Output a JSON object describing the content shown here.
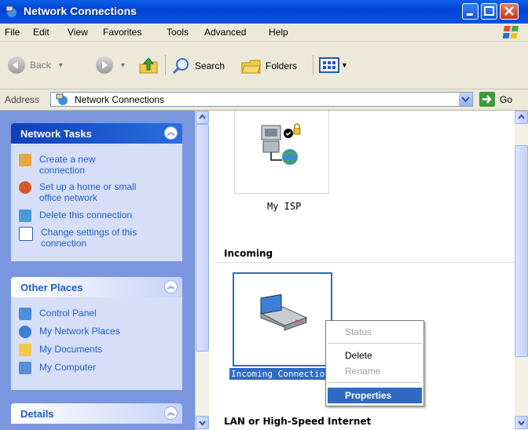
{
  "window": {
    "title": "Network Connections"
  },
  "menu": [
    "File",
    "Edit",
    "View",
    "Favorites",
    "Tools",
    "Advanced",
    "Help"
  ],
  "toolbar": {
    "back_label": "Back",
    "search_label": "Search",
    "folders_label": "Folders"
  },
  "address": {
    "label": "Address",
    "value": "Network Connections",
    "go_label": "Go"
  },
  "network_tasks": {
    "title": "Network Tasks",
    "items": [
      {
        "label": "Create a new connection",
        "icon": "new-connection-icon"
      },
      {
        "label": "Set up a home or small office network",
        "icon": "home-network-icon"
      },
      {
        "label": "Delete this connection",
        "icon": "delete-connection-icon"
      },
      {
        "label": "Change settings of this connection",
        "icon": "settings-icon"
      }
    ]
  },
  "other_places": {
    "title": "Other Places",
    "items": [
      {
        "label": "Control Panel",
        "icon": "control-panel-icon"
      },
      {
        "label": "My Network Places",
        "icon": "network-places-icon"
      },
      {
        "label": "My Documents",
        "icon": "documents-folder-icon"
      },
      {
        "label": "My Computer",
        "icon": "computer-icon"
      }
    ]
  },
  "details": {
    "title": "Details"
  },
  "content": {
    "isp_label": "My ISP",
    "incoming_header": "Incoming",
    "incoming_label": "Incoming Connectior",
    "lan_header": "LAN or High-Speed Internet"
  },
  "context_menu": {
    "status": "Status",
    "delete": "Delete",
    "rename": "Rename",
    "properties": "Properties"
  },
  "colors": {
    "title_bar": "#0343d6",
    "task_pane": "#7a96df",
    "selection": "#316ac5"
  }
}
